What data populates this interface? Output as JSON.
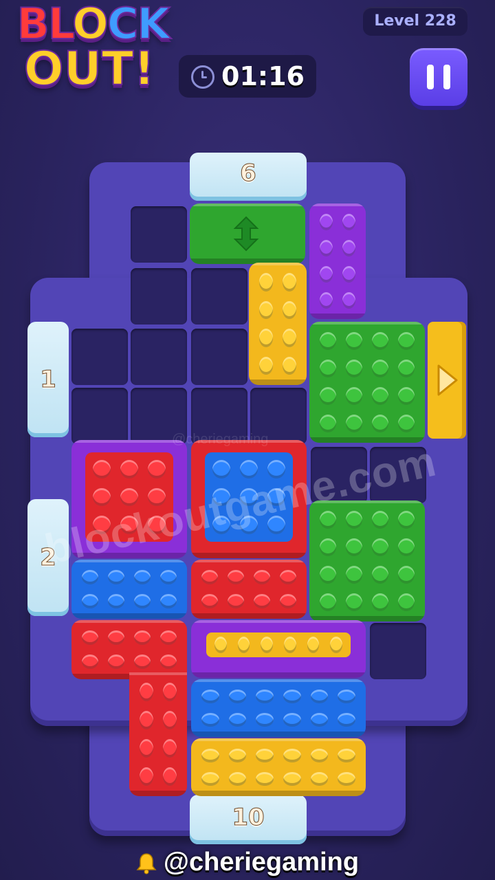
{
  "app": {
    "logo_line1": [
      "BL",
      "O",
      "CK"
    ],
    "logo_line2": "OUT!",
    "level_label": "Level 228",
    "timer": "01:16",
    "pause_icon": "pause-icon"
  },
  "doors": {
    "top": "6",
    "left_upper": "1",
    "left_lower": "2",
    "bottom": "10"
  },
  "exit_right_icon": "play-triangle-icon",
  "move_icon": "vertical-double-arrow-icon",
  "watermark": "blockoutgame.com",
  "watermark_small": "@cheriegaming",
  "footer_handle": "@cheriegaming",
  "colors": {
    "purple": "#8a2fd8",
    "yellow": "#f3b81d",
    "green": "#2fa62f",
    "red": "#e0262c",
    "blue": "#1f6ee6",
    "board": "#5245b6",
    "door_ice": "#d6eef8"
  }
}
